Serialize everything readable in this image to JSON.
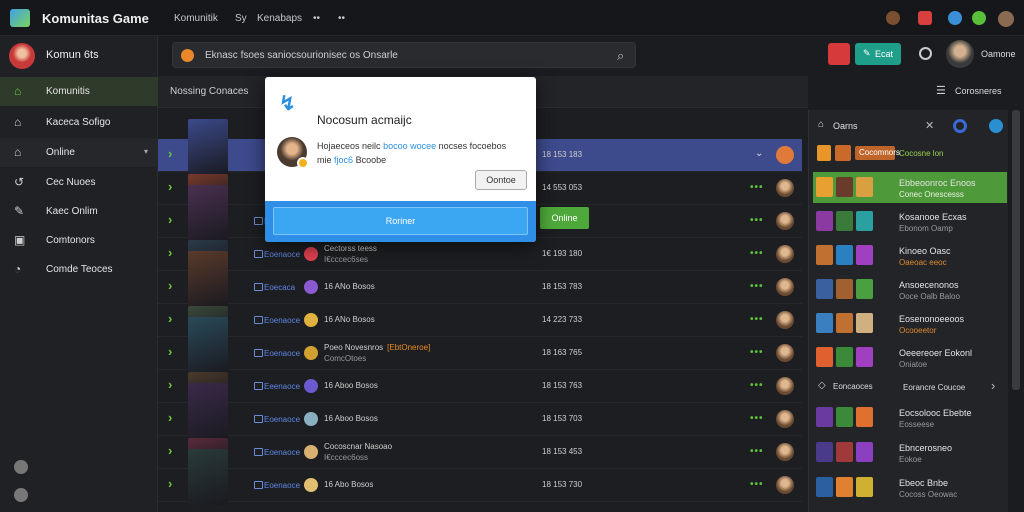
{
  "titlebar": {
    "app_name": "Komunitas Game",
    "menu": [
      "Komunitik",
      "Sy",
      "Kenabaps",
      "••",
      "••"
    ]
  },
  "sidebar": {
    "user_name": "Komun 6ts",
    "items": [
      {
        "label": "Komunitis",
        "icon": "home-icon",
        "active": true
      },
      {
        "label": "Kaceca Sofigo",
        "icon": "house-icon"
      },
      {
        "label": "Online",
        "icon": "house-icon"
      },
      {
        "label": "Cec Nuoes",
        "icon": "history-icon"
      },
      {
        "label": "Kaec Onlim",
        "icon": "pin-icon"
      },
      {
        "label": "Comtonors",
        "icon": "box-icon"
      },
      {
        "label": "Comde Teoces",
        "icon": "compass-icon"
      }
    ]
  },
  "search": {
    "placeholder": "Eknasc fsoes saniocsourionisec os Onsarle"
  },
  "header": {
    "user_name": "Oamone",
    "action_label": "Ecat"
  },
  "main": {
    "title": "Nossing Conaces",
    "header_right": "Corosneres",
    "rows": [
      {
        "c3": "",
        "c4": "18 153 183"
      },
      {
        "c3": "",
        "c4": "14 553 053"
      },
      {
        "tag": "Eoenaoce",
        "c3": "",
        "c4": "",
        "online": "Online"
      },
      {
        "tag": "Eoenaoce",
        "c3": "Cectorss teess",
        "c3b": "I€cccec6ses",
        "c4": "1€ 193 180"
      },
      {
        "tag": "Eoecaca",
        "c3": "16 ANo Bosos",
        "c4": "18 153 783"
      },
      {
        "tag": "Eoenaoce",
        "c3": "16 ANo Bosos",
        "c4": "14 223 733"
      },
      {
        "tag": "Eoenaoce",
        "c3": "Poeo Novesnros",
        "c3o": "[EbtOneroe]",
        "c3b": "ComcOtoes",
        "c4": "18 163 765"
      },
      {
        "tag": "Eeenaoce",
        "c3": "16 Aboo Bosos",
        "c4": "18 153 763"
      },
      {
        "tag": "Eoenaoce",
        "c3": "16 Aboo Bosos",
        "c4": "18 153 703"
      },
      {
        "tag": "Eoenaoce",
        "c3": "Cocoscnar Nasoao",
        "c3b": "I€cccec6oss",
        "c4": "18 153 453"
      },
      {
        "tag": "Eoenaoce",
        "c3": "16 Abo Bosos",
        "c4": "18 153 730"
      }
    ]
  },
  "right_panel": {
    "title": "Oarns",
    "top_item": {
      "t1": "Cocomnors",
      "t2": "Cocosne lon"
    },
    "items": [
      {
        "t1": "Ebbeoonroc Enoos",
        "t2": "Conec Onescesss"
      },
      {
        "t1": "Kosanooe Ecxas",
        "t2": "Ebonom Oamp"
      },
      {
        "t1": "Kinoeo Oasc",
        "t2": "Oaeoac eeoc"
      },
      {
        "t1": "Ansoecenonos",
        "t2": "Ooce Oalb Baloo"
      },
      {
        "t1": "Eosenonoeeoos",
        "t2": "Ocooeetor"
      },
      {
        "t1": "Oeeereoer Eokonl",
        "t2": "Oniatoe"
      }
    ],
    "section_label": "Eoncaoces",
    "section_right": "Eorancre Coucoe",
    "items2": [
      {
        "t1": "Eocsolooc Ebebte",
        "t2": "Eosseese"
      },
      {
        "t1": "Ebncerosneo",
        "t2": "Eokoe"
      },
      {
        "t1": "Ebeoc Bnbe",
        "t2": "Cocoss Oeowac"
      }
    ]
  },
  "modal": {
    "title": "Nocosum acmaijc",
    "body_line1": "Hojaeceos neilc",
    "body_link": "bocoo wocee",
    "body_line1b": "nocses focoebos",
    "body_line2": "mie",
    "body_link2": "fjoc6",
    "body_line2b": "Bcoobe",
    "secondary_button": "Oontoe",
    "primary_button": "Roriner"
  }
}
